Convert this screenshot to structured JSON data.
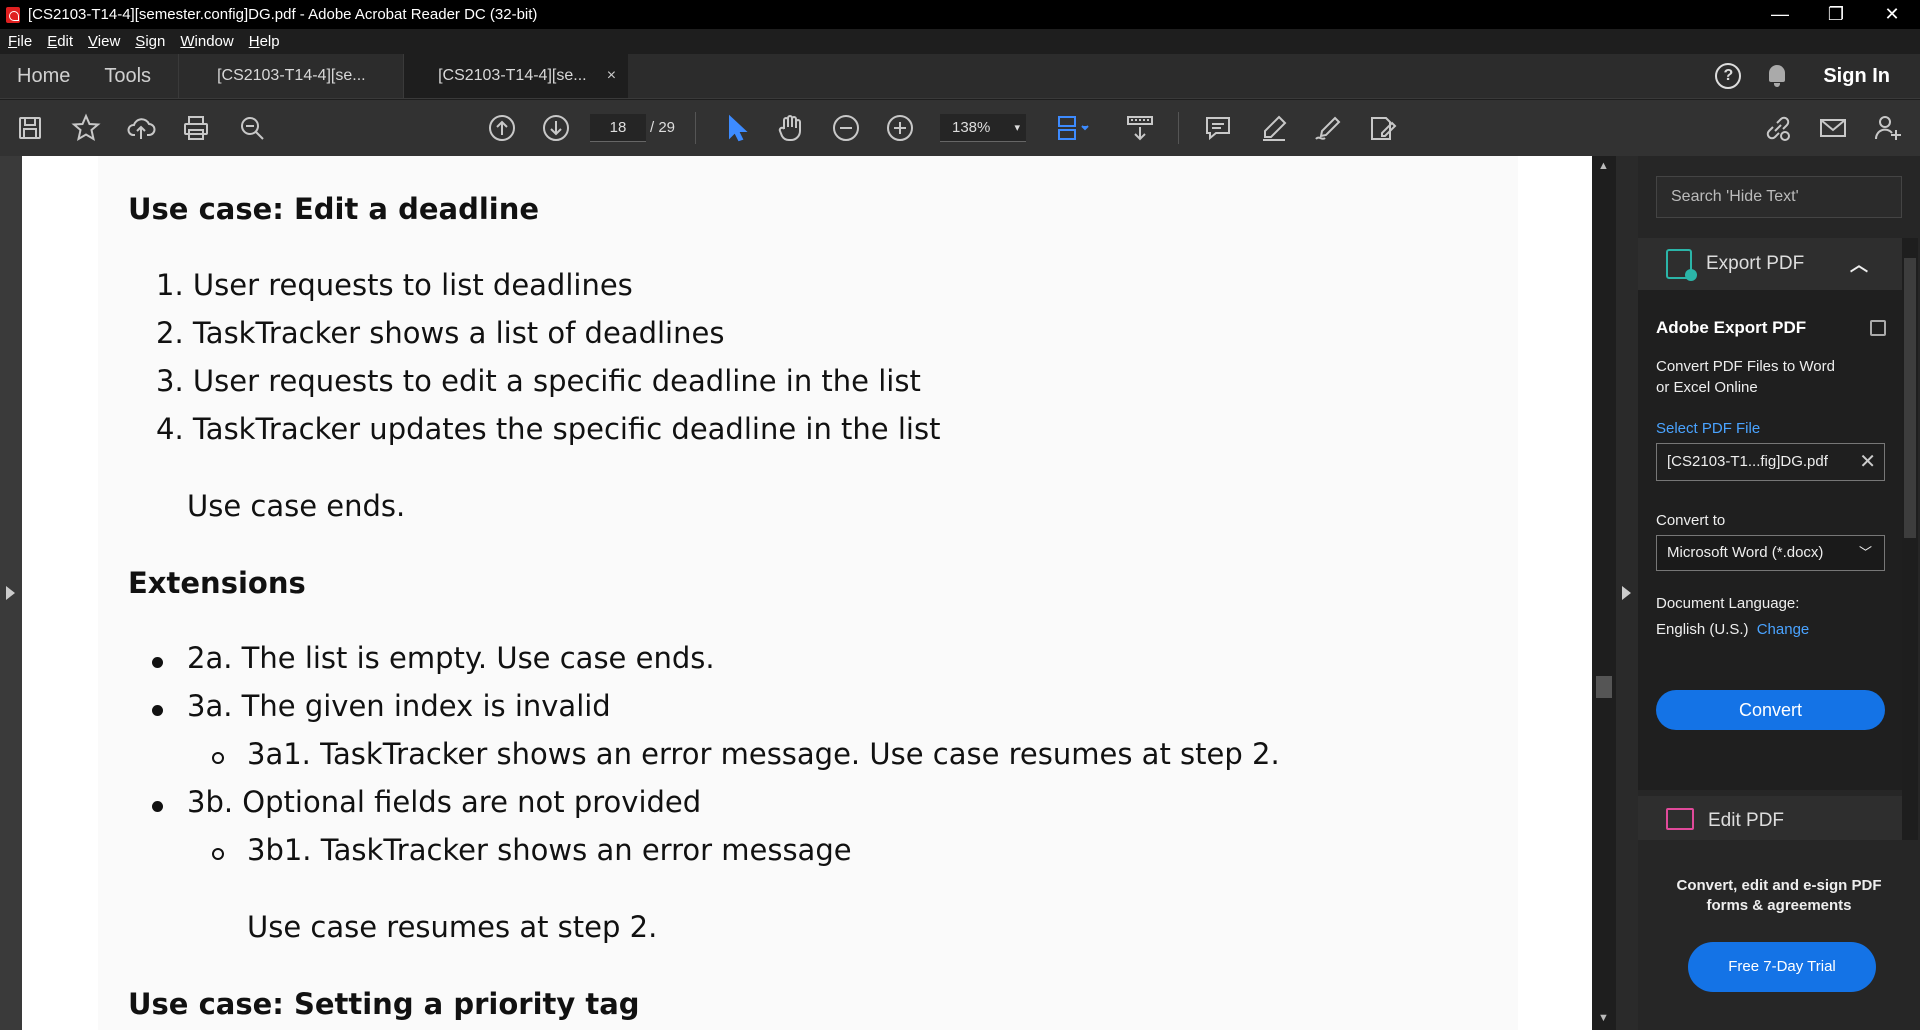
{
  "window": {
    "title": "[CS2103-T14-4][semester.config]DG.pdf - Adobe Acrobat Reader DC (32-bit)"
  },
  "menu": [
    "File",
    "Edit",
    "View",
    "Sign",
    "Window",
    "Help"
  ],
  "tabs": {
    "home": "Home",
    "tools": "Tools",
    "doc1": "[CS2103-T14-4][se...",
    "doc2": "[CS2103-T14-4][se...",
    "close": "×",
    "signin": "Sign In",
    "help": "?"
  },
  "toolbar": {
    "page_current": "18",
    "page_total": "/ 29",
    "zoom": "138%",
    "dropdown": "▾"
  },
  "document": {
    "heading1": "Use case: Edit a deadline",
    "steps": [
      "1. User requests to list deadlines",
      "2. TaskTracker shows a list of deadlines",
      "3. User requests to edit a specific deadline in the list",
      "4. TaskTracker updates the specific deadline in the list"
    ],
    "ends": "Use case ends.",
    "heading2": "Extensions",
    "ext1": "2a. The list is empty. Use case ends.",
    "ext2": "3a. The given index is invalid",
    "ext2a": "3a1. TaskTracker shows an error message. Use case resumes at step 2.",
    "ext3": "3b. Optional fields are not provided",
    "ext3a": "3b1. TaskTracker shows an error message",
    "resume": "Use case resumes at step 2.",
    "heading3": "Use case: Setting a priority tag"
  },
  "rightpane": {
    "search_placeholder": "Search 'Hide Text'",
    "export_label": "Export PDF",
    "export_title": "Adobe Export PDF",
    "export_desc1": "Convert PDF Files to Word",
    "export_desc2": "or Excel Online",
    "select_file": "Select PDF File",
    "file_name": "[CS2103-T1...fig]DG.pdf",
    "convert_to": "Convert to",
    "format": "Microsoft Word (*.docx)",
    "doc_lang": "Document Language:",
    "lang_value": "English (U.S.)",
    "change": "Change",
    "convert_btn": "Convert",
    "edit_label": "Edit PDF",
    "promo1": "Convert, edit and e-sign PDF",
    "promo2": "forms & agreements",
    "trial_btn": "Free 7-Day Trial"
  },
  "colors": {
    "accent": "#1473e6",
    "link": "#4aa3ff",
    "export_icon": "#2bb5a8",
    "edit_icon": "#e04a9a",
    "select_tool": "#3d8bff"
  }
}
